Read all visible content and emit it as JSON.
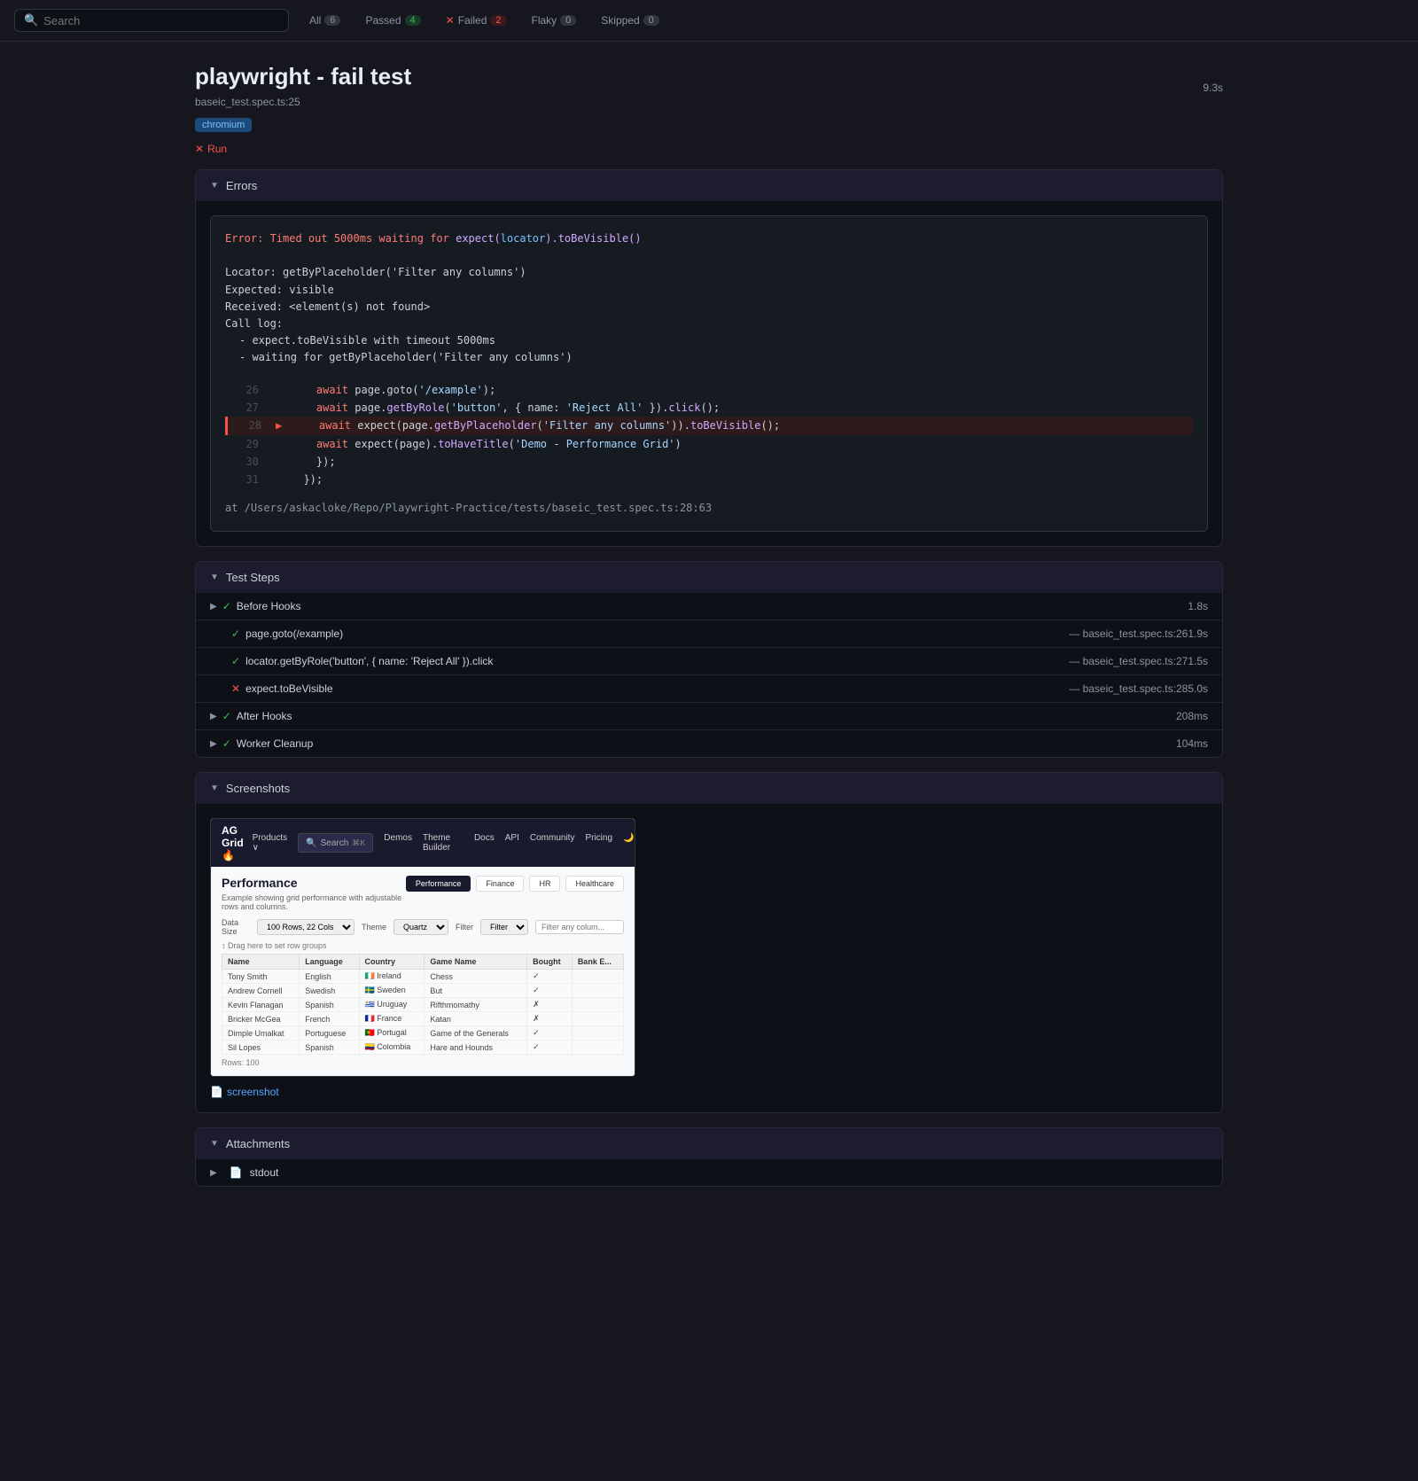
{
  "topbar": {
    "search_placeholder": "Search",
    "filters": [
      {
        "label": "All",
        "count": "6",
        "type": "all"
      },
      {
        "label": "Passed",
        "count": "4",
        "type": "passed"
      },
      {
        "label": "Failed",
        "count": "2",
        "type": "failed"
      },
      {
        "label": "Flaky",
        "count": "0",
        "type": "flaky"
      },
      {
        "label": "Skipped",
        "count": "0",
        "type": "skipped"
      }
    ]
  },
  "test": {
    "title": "playwright - fail test",
    "file": "baseic_test.spec.ts:25",
    "duration": "9.3s",
    "browser": "chromium",
    "run_label": "Run"
  },
  "errors": {
    "section_label": "Errors",
    "error_text": "Error: Timed out 5000ms waiting for expect(locator).toBeVisible()",
    "locator_lines": [
      "Locator: getByPlaceholder('Filter any columns')",
      "Expected: visible",
      "Received: <element(s) not found>",
      "Call log:",
      "  - expect.toBeVisible with timeout 5000ms",
      "  - waiting for getByPlaceholder('Filter any columns')"
    ],
    "code_lines": [
      {
        "num": "26",
        "arrow": "",
        "content": "await page.goto('/example');"
      },
      {
        "num": "27",
        "arrow": "",
        "content": "await page.getByRole('button', { name: 'Reject All' }).click();"
      },
      {
        "num": "28",
        "arrow": ">",
        "content": "await expect(page.getByPlaceholder('Filter any columns')).toBeVisible();"
      },
      {
        "num": "29",
        "arrow": "",
        "content": "await expect(page).toHaveTitle('Demo - Performance Grid')"
      },
      {
        "num": "30",
        "arrow": "",
        "content": "});"
      },
      {
        "num": "31",
        "arrow": "",
        "content": "});"
      }
    ],
    "file_ref": "at /Users/askacloke/Repo/Playwright-Practice/tests/baseic_test.spec.ts:28:63"
  },
  "test_steps": {
    "section_label": "Test Steps",
    "steps": [
      {
        "expandable": true,
        "status": "pass",
        "name": "Before Hooks",
        "file": "",
        "duration": "1.8s",
        "level": 0
      },
      {
        "expandable": false,
        "status": "pass",
        "name": "page.goto(/example)",
        "file": "— baseic_test.spec.ts:26",
        "duration": "1.9s",
        "level": 1
      },
      {
        "expandable": false,
        "status": "pass",
        "name": "locator.getByRole('button', { name: 'Reject All' }).click",
        "file": "— baseic_test.spec.ts:27",
        "duration": "1.5s",
        "level": 1
      },
      {
        "expandable": false,
        "status": "fail",
        "name": "expect.toBeVisible",
        "file": "— baseic_test.spec.ts:28",
        "duration": "5.0s",
        "level": 1
      },
      {
        "expandable": true,
        "status": "pass",
        "name": "After Hooks",
        "file": "",
        "duration": "208ms",
        "level": 0
      },
      {
        "expandable": true,
        "status": "pass",
        "name": "Worker Cleanup",
        "file": "",
        "duration": "104ms",
        "level": 0
      }
    ]
  },
  "screenshots": {
    "section_label": "Screenshots",
    "screenshot_link": "screenshot"
  },
  "attachments": {
    "section_label": "Attachments",
    "items": [
      {
        "name": "stdout"
      }
    ]
  },
  "ag_grid": {
    "logo": "AG Grid 🔥",
    "nav_items": [
      "Products ∨",
      "🔍 Search",
      "Demos",
      "Theme Builder",
      "Docs",
      "API",
      "Community",
      "Pricing"
    ],
    "title": "Performance",
    "subtitle": "Example showing grid performance with adjustable rows and columns.",
    "tabs": [
      "Performance",
      "Finance",
      "HR",
      "Healthcare"
    ],
    "active_tab": "Performance",
    "toolbar": {
      "data_size": "100 Rows, 22 Cols",
      "theme": "Quartz",
      "filter": "Filter",
      "filter_placeholder": "Filter any colum..."
    },
    "columns": [
      "Name",
      "Language",
      "Country",
      "Game Name",
      "Bought",
      "Bank E..."
    ],
    "rows": [
      [
        "Tony Smith",
        "English",
        "🇮🇪 Ireland",
        "Chess",
        "✓",
        ""
      ],
      [
        "Andrew Cornell",
        "Swedish",
        "🇸🇪 Sweden",
        "But",
        "✓",
        ""
      ],
      [
        "Kevin Flanagan",
        "Spanish",
        "🇺🇾 Uruguay",
        "Rifthmomathy",
        "✗",
        ""
      ],
      [
        "Bricker McGea",
        "French",
        "🇫🇷 France",
        "Katan",
        "✗",
        ""
      ],
      [
        "Dimple Umalkat",
        "Portuguese",
        "🇵🇹 Portugal",
        "Game of the Generals",
        "✓",
        ""
      ],
      [
        "Sil Lopes",
        "Spanish",
        "🇨🇴 Colombia",
        "Hare and Hounds",
        "✓",
        ""
      ]
    ]
  }
}
